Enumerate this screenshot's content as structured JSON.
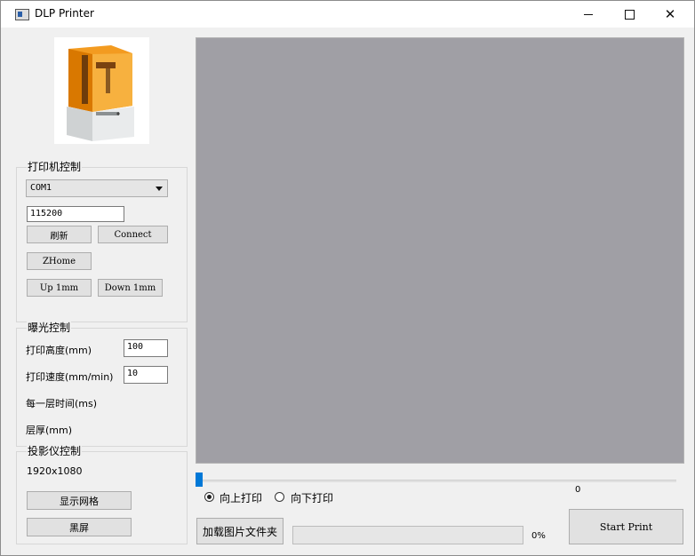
{
  "window": {
    "title": "DLP Printer",
    "minimize_icon": "minimize-icon",
    "maximize_icon": "maximize-icon",
    "close_icon": "close-icon"
  },
  "printer_image": {
    "name": "DLP printer illustration"
  },
  "printer_control": {
    "title": "打印机控制",
    "port_value": "COM1",
    "baud_value": "115200",
    "refresh_label": "刷新",
    "connect_label": "Connect",
    "zhome_label": "ZHome",
    "up_label": "Up 1mm",
    "down_label": "Down 1mm"
  },
  "exposure_control": {
    "title": "曝光控制",
    "height_label": "打印高度(mm)",
    "height_value": "100",
    "speed_label": "打印速度(mm/min)",
    "speed_value": "10",
    "layer_time_label": "每一层时间(ms)",
    "layer_thickness_label": "层厚(mm)"
  },
  "projector_control": {
    "title": "投影仪控制",
    "resolution": "1920x1080",
    "grid_label": "显示网格",
    "black_label": "黑屏"
  },
  "preview": {
    "background": "#a09fa5"
  },
  "slider": {
    "value": "0",
    "position": 0
  },
  "direction": {
    "up_label": "向上打印",
    "down_label": "向下打印",
    "selected": "up"
  },
  "actions": {
    "load_folder_label": "加载图片文件夹",
    "start_label": "Start Print"
  },
  "progress": {
    "text": "0%",
    "value": 0
  }
}
